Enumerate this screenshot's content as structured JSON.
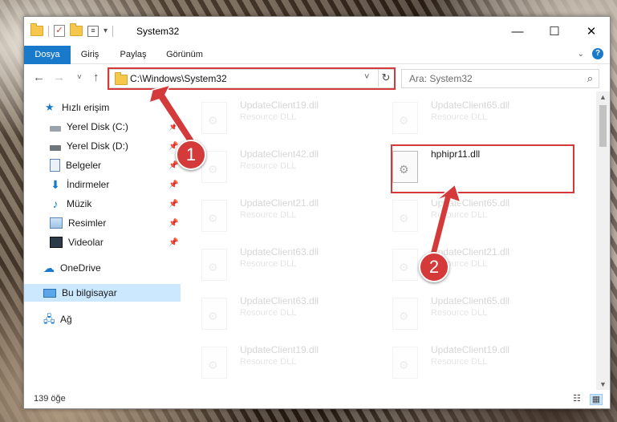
{
  "window": {
    "title": "System32",
    "controls": {
      "minimize": "—",
      "maximize": "☐",
      "close": "✕"
    }
  },
  "ribbon": {
    "tabs": [
      "Dosya",
      "Giriş",
      "Paylaş",
      "Görünüm"
    ],
    "help": "?"
  },
  "navigation": {
    "back": "←",
    "forward": "→",
    "recent": "˅",
    "up": "↑",
    "address": "C:\\Windows\\System32",
    "refresh": "↻",
    "search_placeholder": "Ara: System32"
  },
  "sidebar": {
    "items": [
      {
        "label": "Hızlı erişim",
        "icon": "star-icon"
      },
      {
        "label": "Yerel Disk (C:)",
        "icon": "drive-icon",
        "pinned": true
      },
      {
        "label": "Yerel Disk (D:)",
        "icon": "drive-icon",
        "pinned": true
      },
      {
        "label": "Belgeler",
        "icon": "documents-icon",
        "pinned": true
      },
      {
        "label": "İndirmeler",
        "icon": "download-icon",
        "pinned": true
      },
      {
        "label": "Müzik",
        "icon": "music-icon",
        "pinned": true
      },
      {
        "label": "Resimler",
        "icon": "pictures-icon",
        "pinned": true
      },
      {
        "label": "Videolar",
        "icon": "video-icon",
        "pinned": true
      },
      {
        "label": "OneDrive",
        "icon": "cloud-icon"
      },
      {
        "label": "Bu bilgisayar",
        "icon": "computer-icon",
        "selected": true
      },
      {
        "label": "Ağ",
        "icon": "network-icon"
      }
    ]
  },
  "files": {
    "left_column": [
      {
        "name": "UpdateClient19.dll",
        "desc": "Resource DLL"
      },
      {
        "name": "UpdateClient42.dll",
        "desc": "Resource DLL"
      },
      {
        "name": "UpdateClient21.dll",
        "desc": "Resource DLL"
      },
      {
        "name": "UpdateClient63.dll",
        "desc": "Resource DLL"
      },
      {
        "name": "UpdateClient63.dll",
        "desc": "Resource DLL"
      },
      {
        "name": "UpdateClient19.dll",
        "desc": "Resource DLL"
      }
    ],
    "right_column": [
      {
        "name": "UpdateClient65.dll",
        "desc": "Resource DLL"
      },
      {
        "name": "hphipr11.dll",
        "desc": ""
      },
      {
        "name": "UpdateClient65.dll",
        "desc": "Resource DLL"
      },
      {
        "name": "UpdateClient21.dll",
        "desc": "Resource DLL"
      },
      {
        "name": "UpdateClient65.dll",
        "desc": "Resource DLL"
      },
      {
        "name": "UpdateClient19.dll",
        "desc": "Resource DLL"
      }
    ]
  },
  "status": {
    "count": "139 öğe"
  },
  "annotations": {
    "badge1": "1",
    "badge2": "2",
    "color": "#d43a3a"
  }
}
